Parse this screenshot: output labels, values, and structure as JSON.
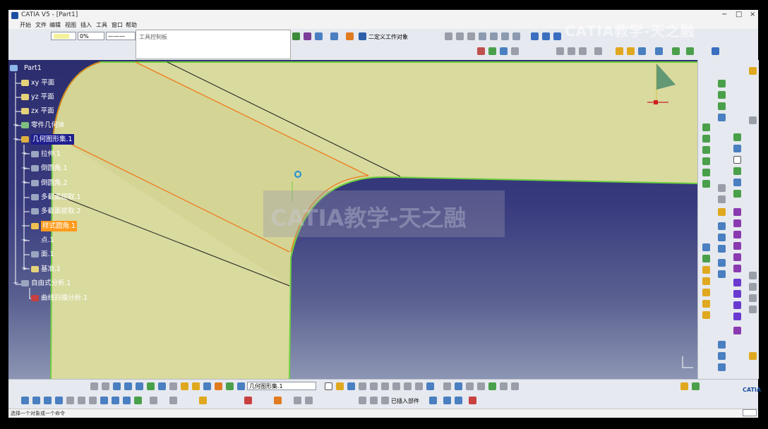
{
  "window": {
    "title": "CATIA V5 - [Part1]",
    "controls": [
      "−",
      "□",
      "×"
    ]
  },
  "menu": [
    "开始",
    "文件",
    "编辑",
    "视图",
    "插入",
    "工具",
    "窗口",
    "帮助"
  ],
  "toolbar_top": {
    "color_combo": "",
    "transparency_combo": "0%",
    "line_combo": "———",
    "tools_palette_label": "工具控制板",
    "set_current_label": "二定义工作对象"
  },
  "watermark": {
    "top": "CATIA教学-天之融",
    "center": "CATIA教学-天之融"
  },
  "tree": {
    "root": "Part1",
    "items": [
      {
        "label": "xy 平面",
        "level": 1,
        "kind": "plane"
      },
      {
        "label": "yz 平面",
        "level": 1,
        "kind": "plane"
      },
      {
        "label": "zx 平面",
        "level": 1,
        "kind": "plane"
      },
      {
        "label": "零件几何体",
        "level": 1,
        "kind": "body"
      },
      {
        "label": "几何图形集.1",
        "level": 1,
        "kind": "set",
        "highlight": true
      },
      {
        "label": "拉伸.1",
        "level": 2,
        "kind": "surface"
      },
      {
        "label": "倒圆角.1",
        "level": 2,
        "kind": "surface"
      },
      {
        "label": "倒圆角.2",
        "level": 2,
        "kind": "surface"
      },
      {
        "label": "多截面提取.1",
        "level": 2,
        "kind": "surface"
      },
      {
        "label": "多截面提取.2",
        "level": 2,
        "kind": "surface"
      },
      {
        "label": "样式圆角.1",
        "level": 2,
        "kind": "fillet",
        "selected": true
      },
      {
        "label": "点.1",
        "level": 2,
        "kind": "point"
      },
      {
        "label": "面.1",
        "level": 2,
        "kind": "surface"
      },
      {
        "label": "基准.1",
        "level": 2,
        "kind": "datum"
      },
      {
        "label": "自由式分析.1",
        "level": 1,
        "kind": "analysis"
      },
      {
        "label": "曲线扫描分析.1",
        "level": 2,
        "kind": "analysis"
      }
    ]
  },
  "bottom_toolbar": {
    "geometric_set_combo": "几何图形集.1",
    "insert_label": "已插入部件",
    "catia_logo": "CATIA"
  },
  "status_bar": "选择一个对象或一个命令",
  "colors": {
    "surface": "#d9da9e",
    "surface_edge": "#6fcf3f",
    "orange_curve": "#f07a1a",
    "background_top": "#2c2d6e",
    "background_bottom": "#8d95b4",
    "selected_bg": "#ff9a1a"
  }
}
